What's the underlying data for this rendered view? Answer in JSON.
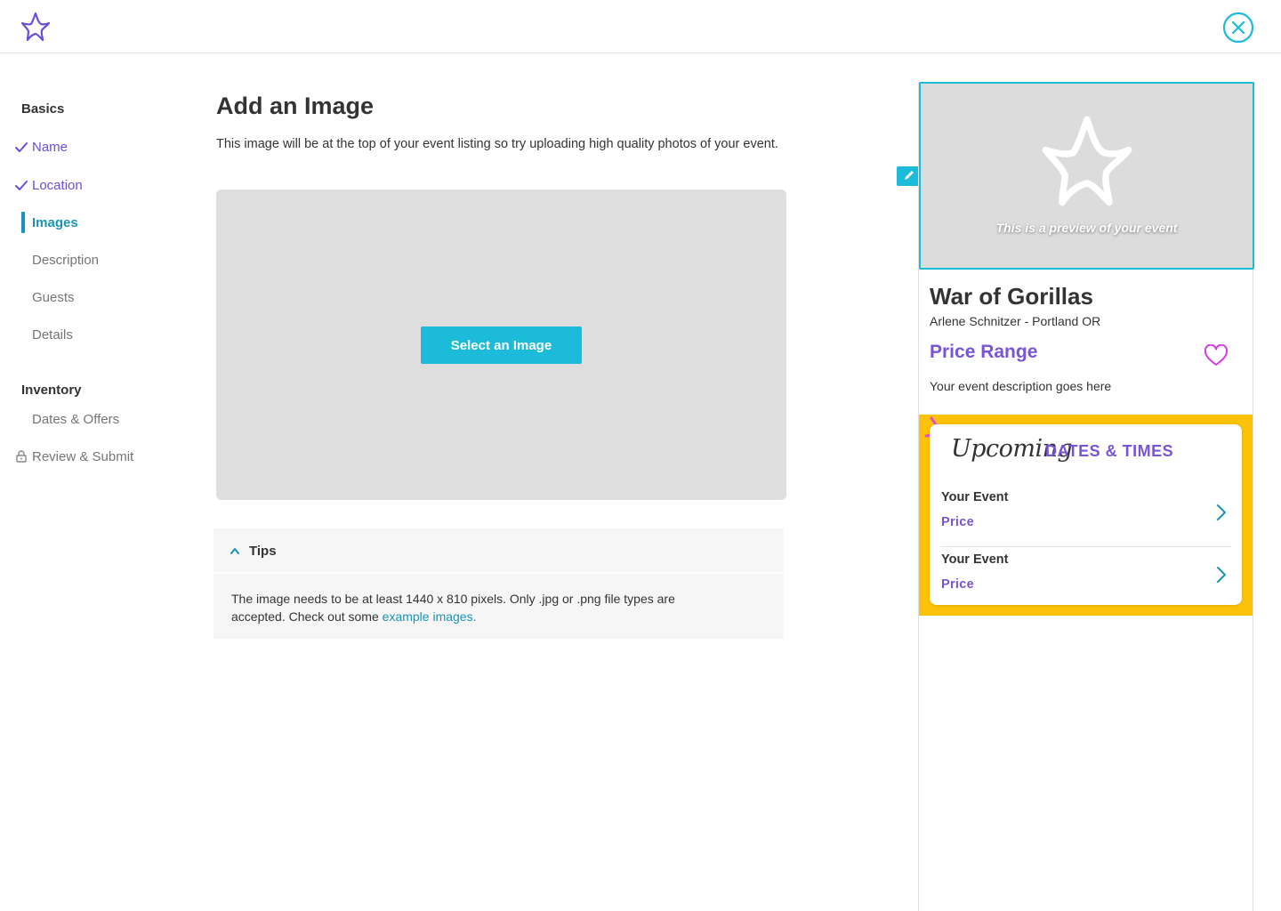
{
  "icons": {
    "logo": "star-logo-icon",
    "close": "close-circle-icon",
    "check": "check-icon",
    "lock": "lock-icon",
    "edit": "pencil-icon",
    "heart": "heart-icon",
    "chevron_up": "chevron-up-icon",
    "chevron_right": "chevron-right-icon"
  },
  "colors": {
    "brand_purple": "#6b4fd8",
    "accent_teal": "#1bbbd9",
    "active_teal": "#1a94b5",
    "heart_pink": "#d63be0",
    "band_yellow": "#fcc20a"
  },
  "sidebar": {
    "basics_title": "Basics",
    "items": [
      {
        "label": "Name",
        "state": "done"
      },
      {
        "label": "Location",
        "state": "done"
      },
      {
        "label": "Images",
        "state": "active"
      },
      {
        "label": "Description",
        "state": "pending"
      },
      {
        "label": "Guests",
        "state": "pending"
      },
      {
        "label": "Details",
        "state": "pending"
      }
    ],
    "inventory_title": "Inventory",
    "inventory_items": [
      {
        "label": "Dates & Offers",
        "state": "pending"
      },
      {
        "label": "Review & Submit",
        "state": "locked"
      }
    ]
  },
  "main": {
    "title": "Add an Image",
    "description": "This image will be at the top of your event listing so try uploading high quality photos of your event.",
    "select_button": "Select an Image",
    "tips": {
      "title": "Tips",
      "expanded": true,
      "body": "The image needs to be at least 1440 x 810 pixels. Only .jpg or .png file types are accepted. Check out some ",
      "link": "example images."
    }
  },
  "preview": {
    "caption": "This is a preview of your event",
    "event_title": "War of Gorillas",
    "venue": "Arlene Schnitzer - Portland OR",
    "price_range": "Price Range",
    "description": "Your event description goes here",
    "upcoming": "Upcoming",
    "dates_times": "DATES & TIMES",
    "events": [
      {
        "name": "Your Event",
        "price": "Price"
      },
      {
        "name": "Your Event",
        "price": "Price"
      }
    ]
  }
}
